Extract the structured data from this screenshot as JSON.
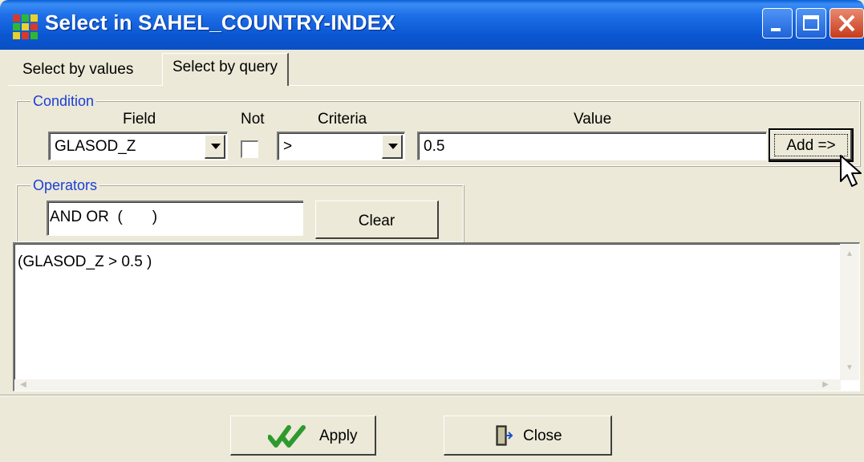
{
  "window": {
    "title": "Select in SAHEL_COUNTRY-INDEX"
  },
  "tabs": [
    {
      "label": "Select by values",
      "active": false
    },
    {
      "label": "Select by query",
      "active": true
    }
  ],
  "condition": {
    "legend": "Condition",
    "field_label": "Field",
    "field_value": "GLASOD_Z",
    "not_label": "Not",
    "not_checked": false,
    "criteria_label": "Criteria",
    "criteria_value": ">",
    "value_label": "Value",
    "value": "0.5",
    "add_button": "Add =>"
  },
  "operators": {
    "legend": "Operators",
    "text": "AND OR  (       )",
    "clear_button": "Clear"
  },
  "query": {
    "text": "(GLASOD_Z > 0.5 )"
  },
  "footer": {
    "apply_button": "Apply",
    "close_button": "Close"
  },
  "colors": {
    "title_bar": "#0a57d2",
    "legend_text": "#1a3fd6",
    "dialog_bg": "#ece9d8",
    "apply_check": "#2e9a2e"
  }
}
